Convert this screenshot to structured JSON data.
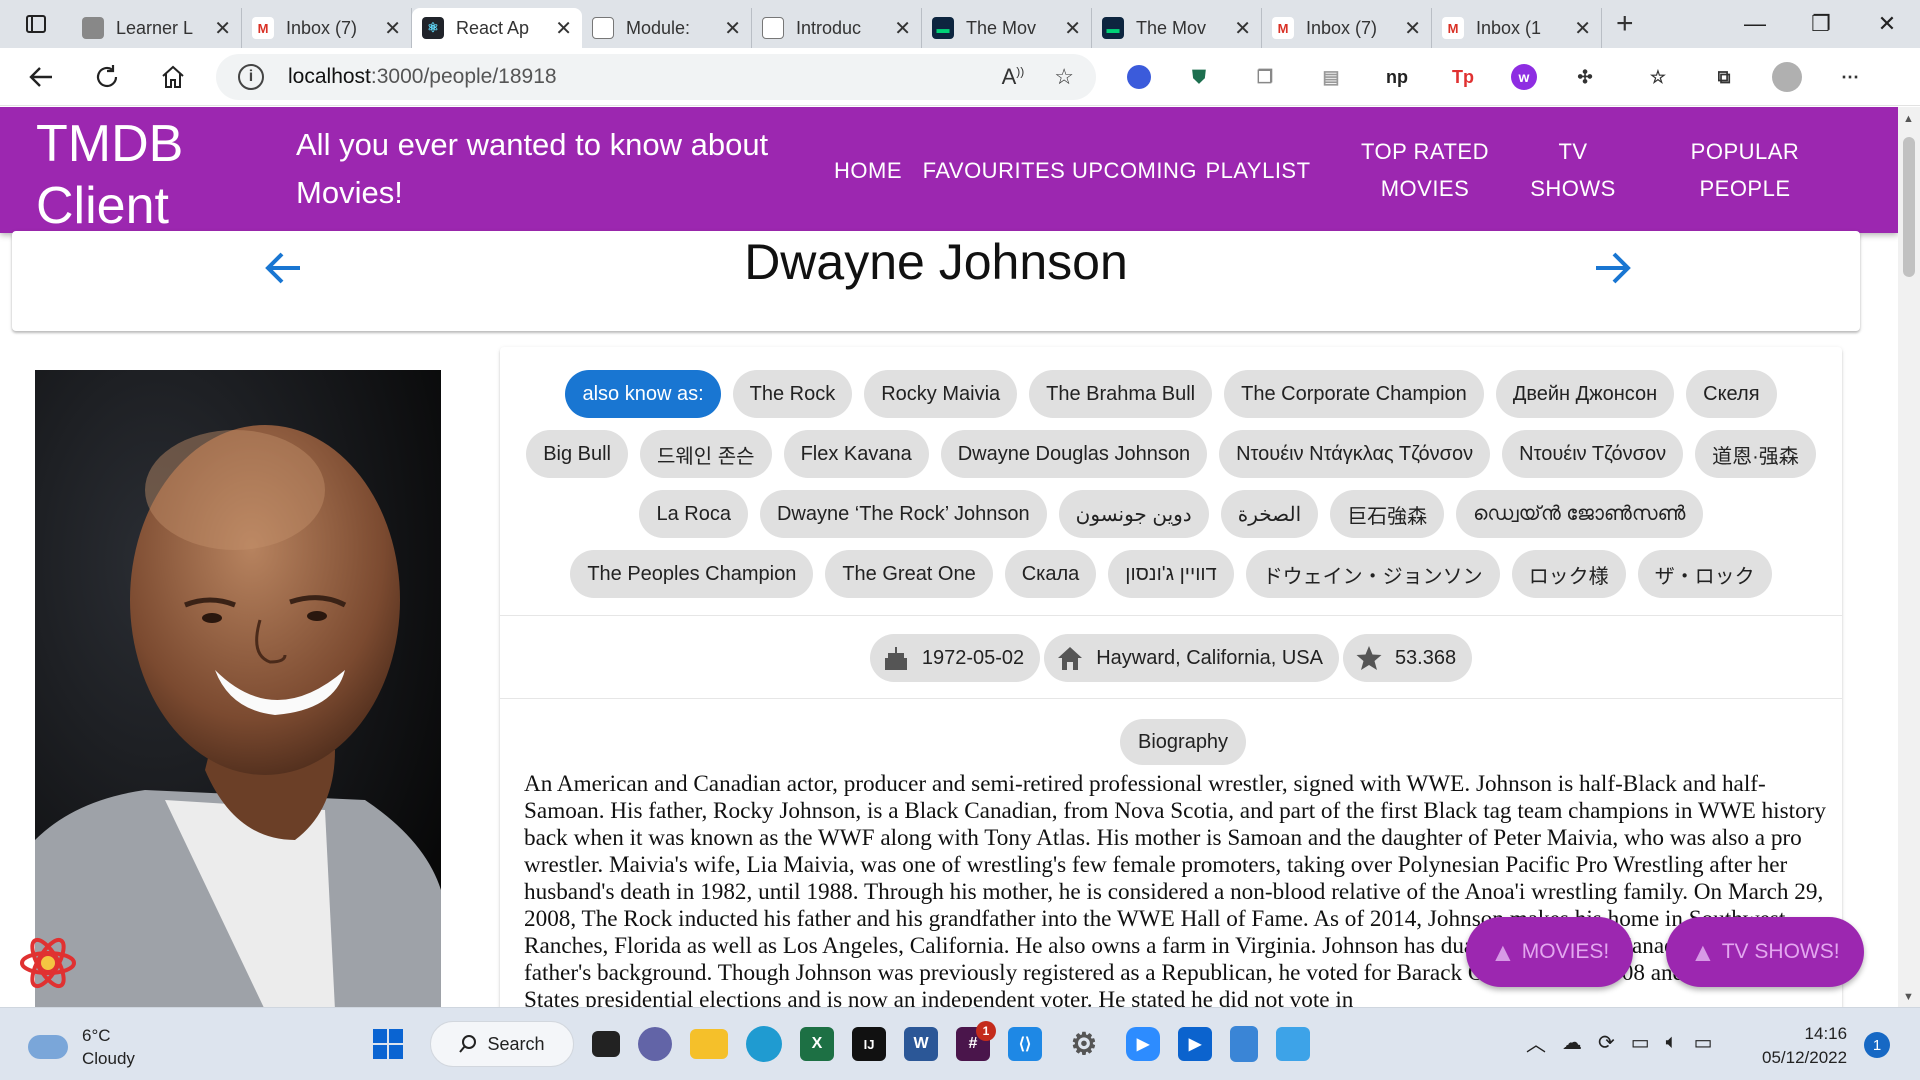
{
  "browser": {
    "tabs": [
      {
        "title": "Learner L",
        "favicon": "aws-icon",
        "active": false
      },
      {
        "title": "Inbox (7)",
        "favicon": "gmail-icon",
        "active": false
      },
      {
        "title": "React Ap",
        "favicon": "react-icon",
        "active": true
      },
      {
        "title": "Module:",
        "favicon": "document-icon",
        "active": false
      },
      {
        "title": "Introduc",
        "favicon": "book-icon",
        "active": false
      },
      {
        "title": "The Mov",
        "favicon": "tmdb-icon",
        "active": false
      },
      {
        "title": "The Mov",
        "favicon": "tmdb-icon",
        "active": false
      },
      {
        "title": "Inbox (7)",
        "favicon": "gmail-icon",
        "active": false
      },
      {
        "title": "Inbox (1",
        "favicon": "gmail-icon",
        "active": false
      }
    ],
    "url_host": "localhost",
    "url_path": ":3000/people/18918"
  },
  "app": {
    "brand": "TMDB Client",
    "tagline": "All you ever wanted to know about Movies!",
    "menu": [
      {
        "label": "HOME"
      },
      {
        "label": "FAVOURITES"
      },
      {
        "label": "UPCOMING"
      },
      {
        "label": "PLAYLIST"
      },
      {
        "label": "TOP RATED MOVIES"
      },
      {
        "label": "TV SHOWS"
      },
      {
        "label": "POPULAR PEOPLE"
      }
    ]
  },
  "person": {
    "name": "Dwayne Johnson",
    "aka_label": "also know as:",
    "aliases": [
      "The Rock",
      "Rocky Maivia",
      "The Brahma Bull",
      "The Corporate Champion",
      "Двейн Джонсон",
      "Скеля",
      "Big Bull",
      "드웨인 존슨",
      "Flex Kavana",
      "Dwayne Douglas Johnson",
      "Ντουέιν Ντάγκλας Τζόνσον",
      "Ντουέιν Τζόνσον",
      "道恩·强森",
      "La Roca",
      "Dwayne ‘The Rock’ Johnson",
      "دوين جونسون",
      "الصخرة",
      "巨石強森",
      "ഡ്വെയ്ൻ ജോൺസൺ",
      "The Peoples Champion",
      "The Great One",
      "Скала",
      "דוויין ג'ונסון",
      "ドウェイン・ジョンソン",
      "ロック様",
      "ザ・ロック"
    ],
    "birthday": "1972-05-02",
    "birthplace": "Hayward, California, USA",
    "popularity": "53.368",
    "bio_label": "Biography",
    "biography": "An American and Canadian actor, producer and semi-retired professional wrestler, signed with WWE. Johnson is half-Black and half-Samoan. His father, Rocky Johnson, is a Black Canadian, from Nova Scotia, and part of the first Black tag team champions in WWE history back when it was known as the WWF along with Tony Atlas. His mother is Samoan and the daughter of Peter Maivia, who was also a pro wrestler. Maivia's wife, Lia Maivia, was one of wrestling's few female promoters, taking over Polynesian Pacific Pro Wrestling after her husband's death in 1982, until 1988. Through his mother, he is considered a non-blood relative of the Anoa'i wrestling family. On March 29, 2008, The Rock inducted his father and his grandfather into the WWE Hall of Fame. As of 2014, Johnson makes his home in Southwest Ranches, Florida as well as Los Angeles, California. He also owns a farm in Virginia. Johnson has dual citizenship in Canada in honor of his father's background. Though Johnson was previously registered as a Republican, he voted for Barack Obama in the 2008 and 2012 United States presidential elections and is now an independent voter. He stated he did not vote in"
  },
  "fabs": {
    "movies": "MOVIES!",
    "tv": "TV SHOWS!"
  },
  "taskbar": {
    "temp": "6°C",
    "condition": "Cloudy",
    "search_label": "Search",
    "time": "14:16",
    "date": "05/12/2022",
    "notifications": "1",
    "teams_badge": "1"
  },
  "colors": {
    "appbar": "#9c27b0",
    "primary": "#1976d2",
    "chip": "#e0e0e0"
  }
}
